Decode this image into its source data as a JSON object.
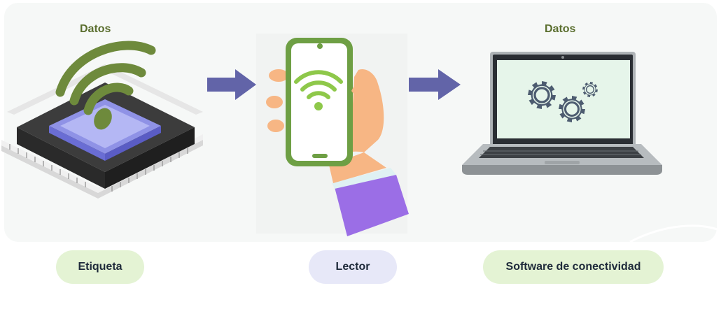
{
  "data_label_left": "Datos",
  "data_label_right": "Datos",
  "steps": [
    {
      "label": "Etiqueta",
      "color": "#e4f3d4"
    },
    {
      "label": "Lector",
      "color": "#e7e8f8"
    },
    {
      "label": "Software de conectividad",
      "color": "#e4f3d4"
    }
  ],
  "colors": {
    "arrow": "#6264a8",
    "wifi_chip": "#6e8a3c",
    "wifi_phone": "#8ec84a",
    "phone_frame": "#6e9f44",
    "sleeve": "#9b6ee6",
    "gear": "#4d5c70"
  },
  "icons": [
    "rfid-chip-icon",
    "arrow-right-icon",
    "phone-reader-icon",
    "laptop-gears-icon"
  ]
}
